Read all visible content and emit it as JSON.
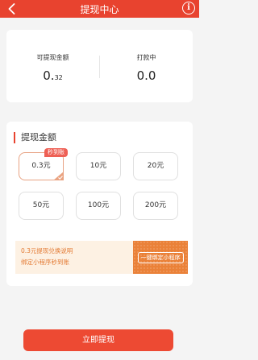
{
  "header": {
    "title": "提现中心",
    "back_icon": "chevron-left-icon",
    "info_label": "i"
  },
  "balance": {
    "withdrawable_label": "可提现金额",
    "withdrawable_int": "0.",
    "withdrawable_dec": "32",
    "paying_label": "打款中",
    "paying_value": "0.0"
  },
  "amount": {
    "section_title": "提现金额",
    "options": [
      "0.3元",
      "10元",
      "20元",
      "50元",
      "100元",
      "200元"
    ],
    "selected_index": 0,
    "badge": "秒到账"
  },
  "promo": {
    "line1": "0.3元提现兑换说明",
    "line2": "绑定小程序秒到账",
    "button": "一键绑定小程序"
  },
  "submit_label": "立即提现",
  "colors": {
    "brand": "#e8432f",
    "accent_orange": "#ea8138",
    "badge": "#ee6055"
  }
}
